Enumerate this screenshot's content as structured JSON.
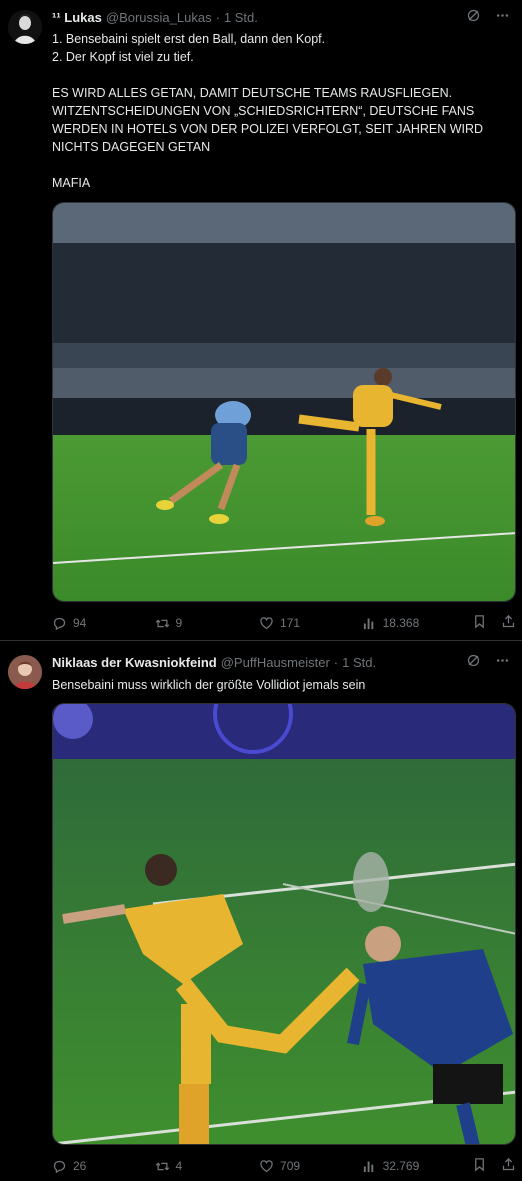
{
  "tweets": [
    {
      "name": "Lukas",
      "name_prefix": "¹¹",
      "handle": "@Borussia_Lukas",
      "time": "1 Std.",
      "text": "1. Bensebaini spielt erst den Ball, dann den Kopf.\n2. Der Kopf ist viel zu tief.\n\nES WIRD ALLES GETAN, DAMIT DEUTSCHE TEAMS RAUSFLIEGEN. WITZENTSCHEIDUNGEN VON „SCHIEDSRICHTERN“, DEUTSCHE FANS WERDEN IN HOTELS VON DER POLIZEI VERFOLGT, SEIT JAHREN WIRD NICHTS DAGEGEN GETAN\n\nMAFIA",
      "replies": "94",
      "retweets": "9",
      "likes": "171",
      "views": "18.368"
    },
    {
      "name": "Niklaas der Kwasniokfeind",
      "handle": "@PuffHausmeister",
      "time": "1 Std.",
      "text": "Bensebaini muss wirklich der größte Vollidiot jemals sein",
      "replies": "26",
      "retweets": "4",
      "likes": "709",
      "views": "32.769"
    }
  ],
  "dot": "·",
  "colors": {
    "background": "#000000",
    "text": "#e7e9ea",
    "muted": "#71767b",
    "border": "#2f3336",
    "pitch": "#3f8f2e",
    "yellow_kit": "#e8b530",
    "blue_kit": "#1f3f8a"
  }
}
